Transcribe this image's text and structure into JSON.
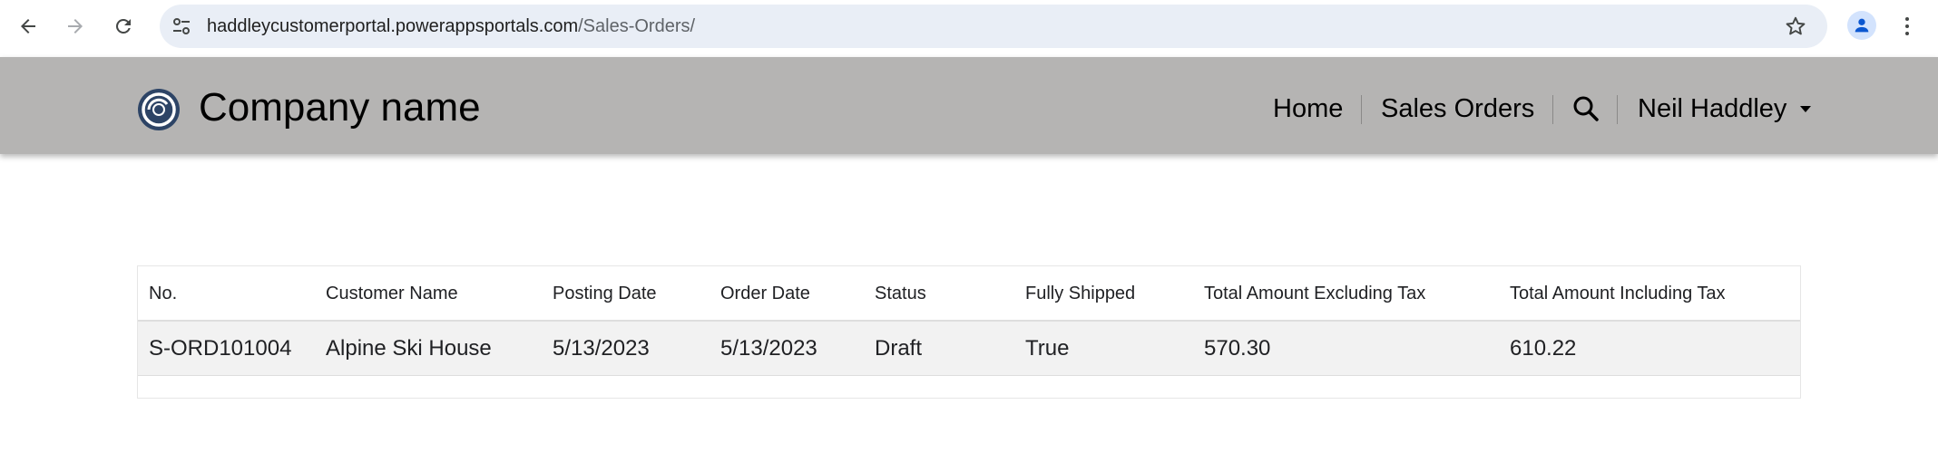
{
  "browser": {
    "url_host": "haddleycustomerportal.powerappsportals.com",
    "url_path": "/Sales-Orders/",
    "icons": {
      "back": "arrow-back-icon",
      "forward": "arrow-forward-icon",
      "reload": "reload-icon",
      "site_info": "tune-icon",
      "bookmark": "star-icon",
      "profile": "person-icon",
      "menu": "more-vert-icon"
    }
  },
  "header": {
    "company_name": "Company name",
    "nav": {
      "home": "Home",
      "sales_orders": "Sales Orders",
      "user": "Neil Haddley"
    },
    "colors": {
      "background": "#b5b4b3",
      "logo": "#2d4466"
    }
  },
  "table": {
    "columns": [
      "No.",
      "Customer Name",
      "Posting Date",
      "Order Date",
      "Status",
      "Fully Shipped",
      "Total Amount Excluding Tax",
      "Total Amount Including Tax"
    ],
    "rows": [
      [
        "S-ORD101004",
        "Alpine Ski House",
        "5/13/2023",
        "5/13/2023",
        "Draft",
        "True",
        "570.30",
        "610.22"
      ]
    ]
  }
}
